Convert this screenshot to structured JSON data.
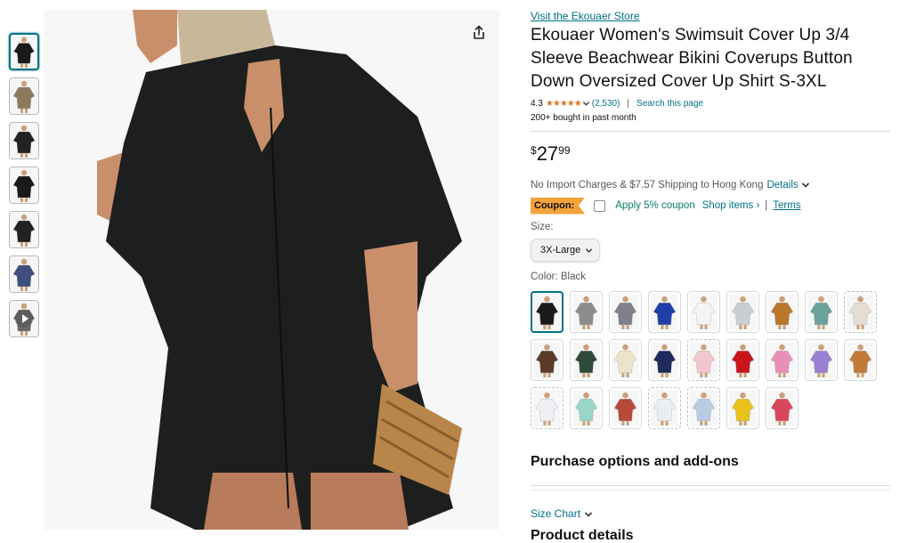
{
  "store": {
    "link_text": "Visit the Ekouaer Store"
  },
  "product": {
    "title": "Ekouaer Women's Swimsuit Cover Up 3/4 Sleeve Beachwear Bikini Coverups Button Down Oversized Cover Up Shirt S-3XL",
    "rating": "4.3",
    "stars_glyphs": "★★★★★",
    "rating_count": "(2,530)",
    "search_page": "Search this page",
    "bought": "200+ bought in past month"
  },
  "price": {
    "symbol": "$",
    "whole": "27",
    "fraction": "99"
  },
  "shipping": {
    "text": "No Import Charges & $7.57 Shipping to Hong Kong",
    "details": "Details"
  },
  "coupon": {
    "badge": "Coupon:",
    "apply": "Apply 5% coupon",
    "shop_items": "Shop items ›",
    "separator": "|",
    "terms": "Terms"
  },
  "size": {
    "label": "Size:",
    "selected": "3X-Large"
  },
  "color": {
    "label": "Color: Black"
  },
  "swatches": [
    {
      "color": "#1a1a1a",
      "status": "selected"
    },
    {
      "color": "#8d8d8d",
      "status": "available"
    },
    {
      "color": "#7e8288",
      "status": "available"
    },
    {
      "color": "#1f3fa8",
      "status": "available"
    },
    {
      "color": "#f4f4f4",
      "status": "available"
    },
    {
      "color": "#c9ced3",
      "status": "available"
    },
    {
      "color": "#b8772b",
      "status": "available"
    },
    {
      "color": "#6aa39b",
      "status": "available"
    },
    {
      "color": "#e6ddd2",
      "status": "unavailable"
    },
    {
      "color": "#5b3b27",
      "status": "available"
    },
    {
      "color": "#2f4a3c",
      "status": "available"
    },
    {
      "color": "#ede3c8",
      "status": "available"
    },
    {
      "color": "#1f2b5c",
      "status": "available"
    },
    {
      "color": "#f2c6cf",
      "status": "unavailable"
    },
    {
      "color": "#c8161c",
      "status": "available"
    },
    {
      "color": "#e88fb5",
      "status": "available"
    },
    {
      "color": "#9b7fd0",
      "status": "available"
    },
    {
      "color": "#c17a38",
      "status": "available"
    },
    {
      "color": "#eef0f5",
      "status": "unavailable"
    },
    {
      "color": "#9ad6c8",
      "status": "available"
    },
    {
      "color": "#b84a3a",
      "status": "available"
    },
    {
      "color": "#e9eef5",
      "status": "unavailable"
    },
    {
      "color": "#b9cde2",
      "status": "unavailable"
    },
    {
      "color": "#e8c21a",
      "status": "available"
    },
    {
      "color": "#d8475a",
      "status": "available"
    }
  ],
  "sections": {
    "purchase_options": "Purchase options and add-ons",
    "size_chart": "Size Chart",
    "product_details": "Product details"
  },
  "thumbnails": [
    {
      "name": "thumb-front",
      "color": "#1a1a1a",
      "active": true
    },
    {
      "name": "thumb-beach-collage",
      "color": "#8b7a5c",
      "active": false
    },
    {
      "name": "thumb-side",
      "color": "#222222",
      "active": false
    },
    {
      "name": "thumb-back",
      "color": "#1a1a1a",
      "active": false
    },
    {
      "name": "thumb-model",
      "color": "#222222",
      "active": false
    },
    {
      "name": "thumb-detail",
      "color": "#3d4f7a",
      "active": false
    },
    {
      "name": "thumb-video",
      "color": "#6a6a6a",
      "active": false
    }
  ],
  "colors": {
    "link": "#007185",
    "accent_star": "#de7921",
    "coupon_badge": "#f2a33a",
    "coupon_text": "#067d62"
  }
}
